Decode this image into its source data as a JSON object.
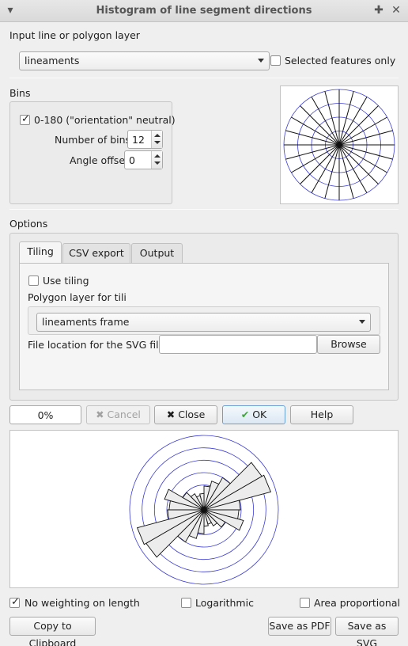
{
  "window": {
    "title": "Histogram of line segment directions"
  },
  "input": {
    "label": "Input line or polygon layer",
    "layer": "lineaments",
    "selected_only_label": "Selected features only",
    "selected_only_checked": false
  },
  "bins": {
    "label": "Bins",
    "orientation_label": "0-180 (\"orientation\" neutral)",
    "orientation_checked": true,
    "num_bins_label": "Number of bins:",
    "num_bins": "12",
    "angle_offset_label": "Angle offset",
    "angle_offset": "0"
  },
  "options": {
    "label": "Options",
    "tabs": [
      "Tiling",
      "CSV export",
      "Output"
    ],
    "active_tab": "Tiling",
    "tiling": {
      "use_tiling_label": "Use tiling",
      "use_tiling_checked": false,
      "polygon_layer_label": "Polygon layer for tiling",
      "polygon_layer": "lineaments frame",
      "svg_location_label": "File location for the SVG files:",
      "svg_location_value": "",
      "browse_label": "Browse"
    }
  },
  "actions": {
    "progress": "0%",
    "progress_value": 0,
    "cancel_label": "Cancel",
    "close_label": "Close",
    "ok_label": "OK",
    "help_label": "Help"
  },
  "bottom": {
    "no_weighting_label": "No weighting on length",
    "no_weighting_checked": true,
    "logarithmic_label": "Logarithmic",
    "logarithmic_checked": false,
    "area_proportional_label": "Area proportional",
    "area_proportional_checked": false,
    "copy_label": "Copy to Clipboard",
    "save_pdf_label": "Save as PDF",
    "save_svg_label": "Save as SVG"
  },
  "colors": {
    "ring": "#3b3bd6",
    "petal_fill": "#ececec",
    "petal_stroke": "#111111"
  },
  "chart_data": {
    "type": "rose",
    "bins": 12,
    "bin_width_deg": 15,
    "range_deg": [
      0,
      180
    ],
    "symmetric": true,
    "rings": 6,
    "values": [
      0.32,
      0.4,
      0.5,
      0.9,
      0.93,
      0.49,
      0.47,
      0.55,
      0.33,
      0.25,
      0.2,
      0.22
    ]
  }
}
